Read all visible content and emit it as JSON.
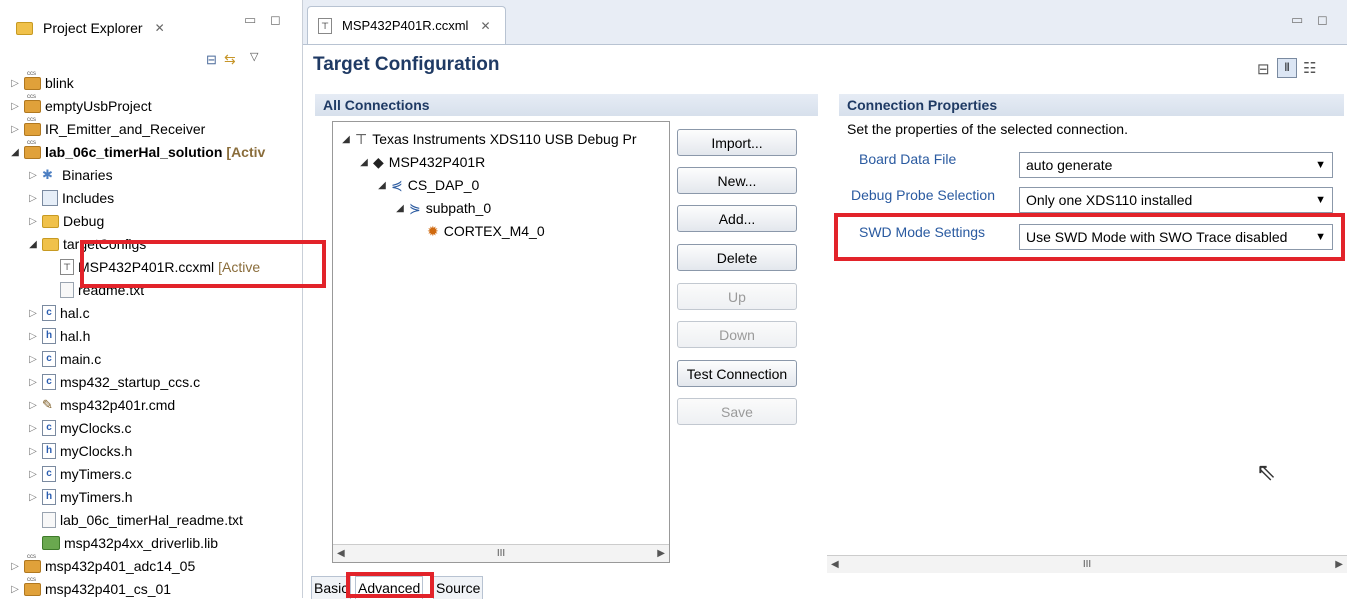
{
  "project_explorer": {
    "title": "Project Explorer",
    "items": [
      {
        "label": "blink",
        "twisty": "▷",
        "icon": "proj",
        "indent": 0
      },
      {
        "label": "emptyUsbProject",
        "twisty": "▷",
        "icon": "proj",
        "indent": 0
      },
      {
        "label": "IR_Emitter_and_Receiver",
        "twisty": "▷",
        "icon": "proj",
        "indent": 0
      },
      {
        "label": "lab_06c_timerHal_solution",
        "suffix": "[Activ",
        "twisty": "◢",
        "icon": "proj",
        "indent": 0,
        "bold": true
      },
      {
        "label": "Binaries",
        "twisty": "▷",
        "icon": "bin",
        "indent": 1
      },
      {
        "label": "Includes",
        "twisty": "▷",
        "icon": "inc",
        "indent": 1
      },
      {
        "label": "Debug",
        "twisty": "▷",
        "icon": "folder",
        "indent": 1
      },
      {
        "label": "targetConfigs",
        "twisty": "◢",
        "icon": "folder",
        "indent": 1
      },
      {
        "label": "MSP432P401R.ccxml",
        "suffix": "[Active",
        "twisty": "",
        "icon": "xml",
        "indent": 2
      },
      {
        "label": "readme.txt",
        "twisty": "",
        "icon": "file-txt",
        "indent": 2
      },
      {
        "label": "hal.c",
        "twisty": "▷",
        "icon": "file-c",
        "indent": 1
      },
      {
        "label": "hal.h",
        "twisty": "▷",
        "icon": "file-h",
        "indent": 1
      },
      {
        "label": "main.c",
        "twisty": "▷",
        "icon": "file-c",
        "indent": 1
      },
      {
        "label": "msp432_startup_ccs.c",
        "twisty": "▷",
        "icon": "file-c",
        "indent": 1
      },
      {
        "label": "msp432p401r.cmd",
        "twisty": "▷",
        "icon": "cmd",
        "indent": 1
      },
      {
        "label": "myClocks.c",
        "twisty": "▷",
        "icon": "file-c",
        "indent": 1
      },
      {
        "label": "myClocks.h",
        "twisty": "▷",
        "icon": "file-h",
        "indent": 1
      },
      {
        "label": "myTimers.c",
        "twisty": "▷",
        "icon": "file-c",
        "indent": 1
      },
      {
        "label": "myTimers.h",
        "twisty": "▷",
        "icon": "file-h",
        "indent": 1
      },
      {
        "label": "lab_06c_timerHal_readme.txt",
        "twisty": "",
        "icon": "file-txt",
        "indent": 1
      },
      {
        "label": "msp432p4xx_driverlib.lib",
        "twisty": "",
        "icon": "lib",
        "indent": 1
      },
      {
        "label": "msp432p401_adc14_05",
        "twisty": "▷",
        "icon": "proj",
        "indent": 0
      },
      {
        "label": "msp432p401_cs_01",
        "twisty": "▷",
        "icon": "proj",
        "indent": 0
      }
    ]
  },
  "editor": {
    "tab_label": "MSP432P401R.ccxml",
    "page_title": "Target Configuration",
    "all_connections": {
      "header": "All Connections",
      "tree": [
        {
          "label": "Texas Instruments XDS110 USB Debug Pr",
          "indent": 0
        },
        {
          "label": "MSP432P401R",
          "indent": 1
        },
        {
          "label": "CS_DAP_0",
          "indent": 2
        },
        {
          "label": "subpath_0",
          "indent": 3
        },
        {
          "label": "CORTEX_M4_0",
          "indent": 4
        }
      ],
      "buttons": {
        "import": "Import...",
        "new": "New...",
        "add": "Add...",
        "delete": "Delete",
        "up": "Up",
        "down": "Down",
        "test": "Test Connection",
        "save": "Save"
      }
    },
    "connection_properties": {
      "header": "Connection Properties",
      "description": "Set the properties of the selected connection.",
      "board_data_file_label": "Board Data File",
      "board_data_file_value": "auto generate",
      "debug_probe_label": "Debug Probe Selection",
      "debug_probe_value": "Only one XDS110 installed",
      "swd_mode_label": "SWD Mode Settings",
      "swd_mode_value": "Use SWD Mode with SWO Trace disabled"
    },
    "bottom_tabs": {
      "basic": "Basic",
      "advanced": "Advanced",
      "source": "Source"
    },
    "scroll_thumb": "III"
  },
  "colors": {
    "highlight": "#e2232a",
    "section_title": "#1f3a64",
    "label_blue": "#2a5aa0"
  }
}
